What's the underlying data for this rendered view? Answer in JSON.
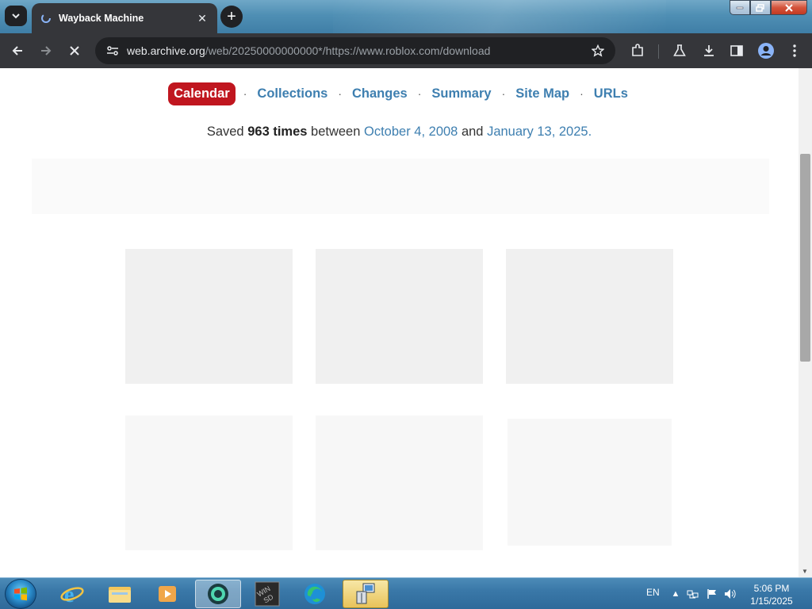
{
  "browser": {
    "tab_title": "Wayback Machine",
    "url_host": "web.archive.org",
    "url_path": "/web/20250000000000*/https://www.roblox.com/download"
  },
  "nav": {
    "items": [
      "Calendar",
      "Collections",
      "Changes",
      "Summary",
      "Site Map",
      "URLs"
    ],
    "active": "Calendar",
    "separator": "·"
  },
  "saved": {
    "prefix": "Saved",
    "count": "963 times",
    "between": "between",
    "start_date": "October 4, 2008",
    "and": "and",
    "end_date": "January 13, 2025."
  },
  "taskbar": {
    "language": "EN",
    "time": "5:06 PM",
    "date": "1/15/2025"
  },
  "colors": {
    "accent_red": "#c0161f",
    "link_blue": "#3e7fb0"
  }
}
